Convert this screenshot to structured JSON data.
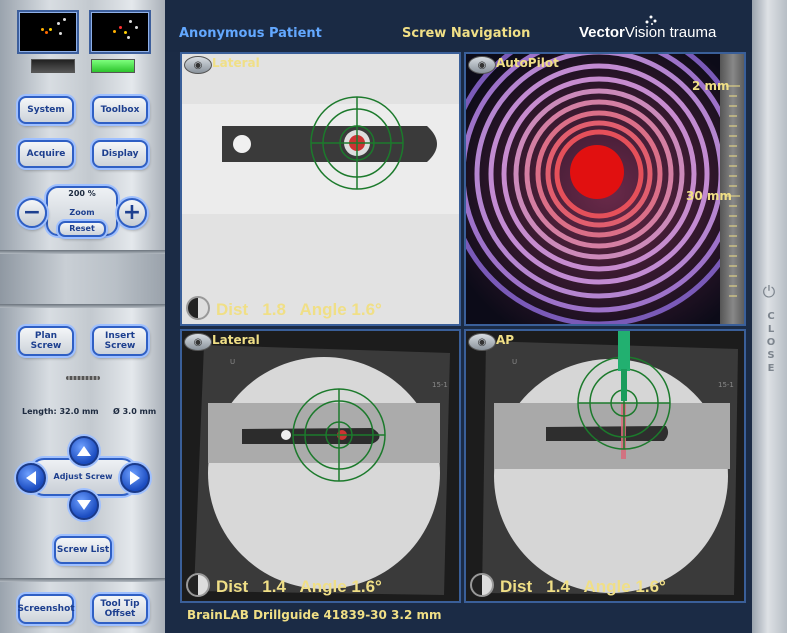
{
  "header": {
    "patient_name": "Anonymous Patient",
    "screen_title": "Screw Navigation",
    "brand_part1": "Vector",
    "brand_part2": "Vision",
    "brand_part3": " trauma"
  },
  "left_panel": {
    "buttons": {
      "system": "System",
      "toolbox": "Toolbox",
      "acquire": "Acquire",
      "display": "Display"
    },
    "zoom": {
      "level": "200 %",
      "label": "Zoom",
      "reset": "Reset",
      "minus": "−",
      "plus": "+"
    },
    "plan_screw": "Plan Screw",
    "insert_screw": "Insert Screw",
    "screw_length": "Length: 32.0 mm",
    "screw_diameter": "Ø 3.0 mm",
    "adjust_screw": "Adjust Screw",
    "screw_list": "Screw List",
    "screenshot": "Screenshot",
    "tool_tip_offset": "Tool Tip Offset"
  },
  "views": {
    "top_left": {
      "label": "Lateral",
      "readout": "Dist   1.8   Angle 1.6°"
    },
    "top_right": {
      "label": "AutoPilot",
      "scale_top": "2 mm",
      "scale_bottom": "30 mm"
    },
    "bottom_left": {
      "label": "Lateral",
      "readout": "Dist   1.4   Angle 1.6°"
    },
    "bottom_right": {
      "label": "AP",
      "readout": "Dist   1.4   Angle 1.6°"
    }
  },
  "footer": {
    "instrument": "BrainLAB Drillguide 41839-30 3.2 mm"
  },
  "right_panel": {
    "close_label": "CLOSE"
  },
  "colors": {
    "accent_yellow": "#f0df86",
    "patient_blue": "#63a8ff",
    "target_green": "#1c7a2c",
    "status_green": "#35d335"
  }
}
